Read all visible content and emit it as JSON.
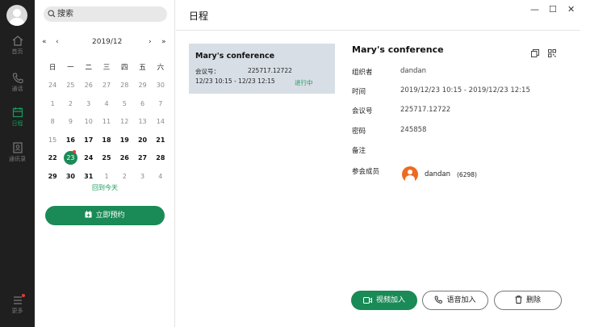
{
  "rail": {
    "items": [
      {
        "label": "首页",
        "icon": "home-icon"
      },
      {
        "label": "通话",
        "icon": "phone-icon"
      },
      {
        "label": "日程",
        "icon": "calendar-icon"
      },
      {
        "label": "通讯录",
        "icon": "contacts-icon"
      }
    ],
    "more_label": "更多"
  },
  "search": {
    "placeholder": "搜索"
  },
  "calendar": {
    "month_label": "2019/12",
    "weekdays": [
      "日",
      "一",
      "二",
      "三",
      "四",
      "五",
      "六"
    ],
    "weeks": [
      [
        "24",
        "25",
        "26",
        "27",
        "28",
        "29",
        "30"
      ],
      [
        "1",
        "2",
        "3",
        "4",
        "5",
        "6",
        "7"
      ],
      [
        "8",
        "9",
        "10",
        "11",
        "12",
        "13",
        "14"
      ],
      [
        "15",
        "16",
        "17",
        "18",
        "19",
        "20",
        "21"
      ],
      [
        "22",
        "23",
        "24",
        "25",
        "26",
        "27",
        "28"
      ],
      [
        "29",
        "30",
        "31",
        "1",
        "2",
        "3",
        "4"
      ]
    ],
    "back_today": "回到今天",
    "book_label": "立即预约"
  },
  "header": {
    "title": "日程"
  },
  "card": {
    "title": "Mary's conference",
    "id_label": "会议号：",
    "id_value": "225717.12722",
    "time": "12/23 10:15 - 12/23 12:15",
    "status": "进行中"
  },
  "detail": {
    "title": "Mary's conference",
    "organizer_label": "组织者",
    "organizer": "dandan",
    "time_label": "时间",
    "time": "2019/12/23 10:15 - 2019/12/23 12:15",
    "id_label": "会议号",
    "id": "225717.12722",
    "password_label": "密码",
    "password": "245858",
    "note_label": "备注",
    "members_label": "参会成员",
    "member_name": "dandan",
    "member_id": "(6298)"
  },
  "actions": {
    "video": "视频加入",
    "voice": "语音加入",
    "delete": "删除"
  },
  "colors": {
    "accent": "#1a8a57",
    "status": "#1a9a5c",
    "member_avatar": "#ee6a1f",
    "card_bg": "#d8dee6"
  }
}
